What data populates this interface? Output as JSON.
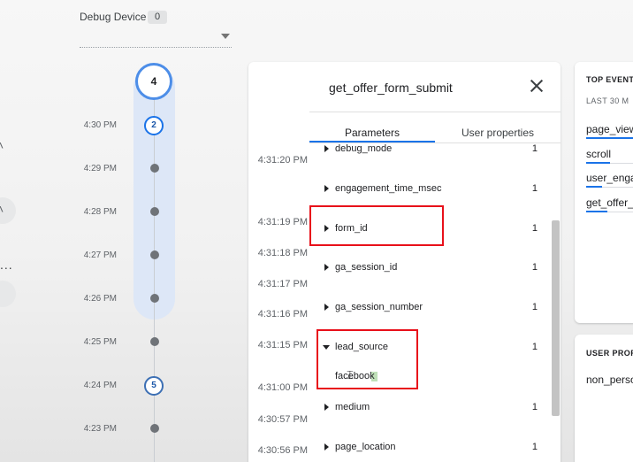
{
  "debug_device": {
    "label": "Debug Device",
    "count": "0"
  },
  "timeline": {
    "top_event_count": "4",
    "items": [
      {
        "time": "4:30 PM",
        "kind": "count",
        "count": "2"
      },
      {
        "time": "4:29 PM",
        "kind": "dot"
      },
      {
        "time": "4:28 PM",
        "kind": "dot"
      },
      {
        "time": "4:27 PM",
        "kind": "dot"
      },
      {
        "time": "4:26 PM",
        "kind": "dot"
      },
      {
        "time": "4:25 PM",
        "kind": "dot"
      },
      {
        "time": "4:24 PM",
        "kind": "count",
        "count": "5"
      },
      {
        "time": "4:23 PM",
        "kind": "dot"
      }
    ]
  },
  "left_stub": {
    "ellipsis": "..."
  },
  "event_panel": {
    "title": "get_offer_form_submit",
    "tabs": {
      "parameters": "Parameters",
      "user_properties": "User properties"
    },
    "times": [
      "4:31:20 PM",
      "4:31:19 PM",
      "4:31:18 PM",
      "4:31:17 PM",
      "4:31:16 PM",
      "4:31:15 PM",
      "4:31:00 PM",
      "4:30:57 PM",
      "4:30:56 PM"
    ],
    "parameters": [
      {
        "name": "debug_mode",
        "count": "1",
        "expanded": false
      },
      {
        "name": "engagement_time_msec",
        "count": "1",
        "expanded": false
      },
      {
        "name": "form_id",
        "count": "1",
        "expanded": false,
        "highlighted": true
      },
      {
        "name": "ga_session_id",
        "count": "1",
        "expanded": false
      },
      {
        "name": "ga_session_number",
        "count": "1",
        "expanded": false
      },
      {
        "name": "lead_source",
        "count": "1",
        "expanded": true,
        "highlighted": true,
        "value": "facebook"
      },
      {
        "name": "medium",
        "count": "1",
        "expanded": false
      },
      {
        "name": "page_location",
        "count": "1",
        "expanded": false
      }
    ]
  },
  "top_events": {
    "heading": "TOP EVENT",
    "subheading": "LAST 30 M",
    "items": [
      {
        "label": "page_view",
        "bar_fraction": 1.0
      },
      {
        "label": "scroll",
        "bar_fraction": 0.45
      },
      {
        "label": "user_enga",
        "bar_fraction": 0.3
      },
      {
        "label": "get_offer_",
        "bar_fraction": 0.4
      }
    ]
  },
  "user_properties": {
    "heading": "USER PROP",
    "item": "non_perso"
  },
  "colors": {
    "accent": "#1a73e8",
    "highlight_box": "#e8101a",
    "timeline_band": "#dde7f7"
  }
}
